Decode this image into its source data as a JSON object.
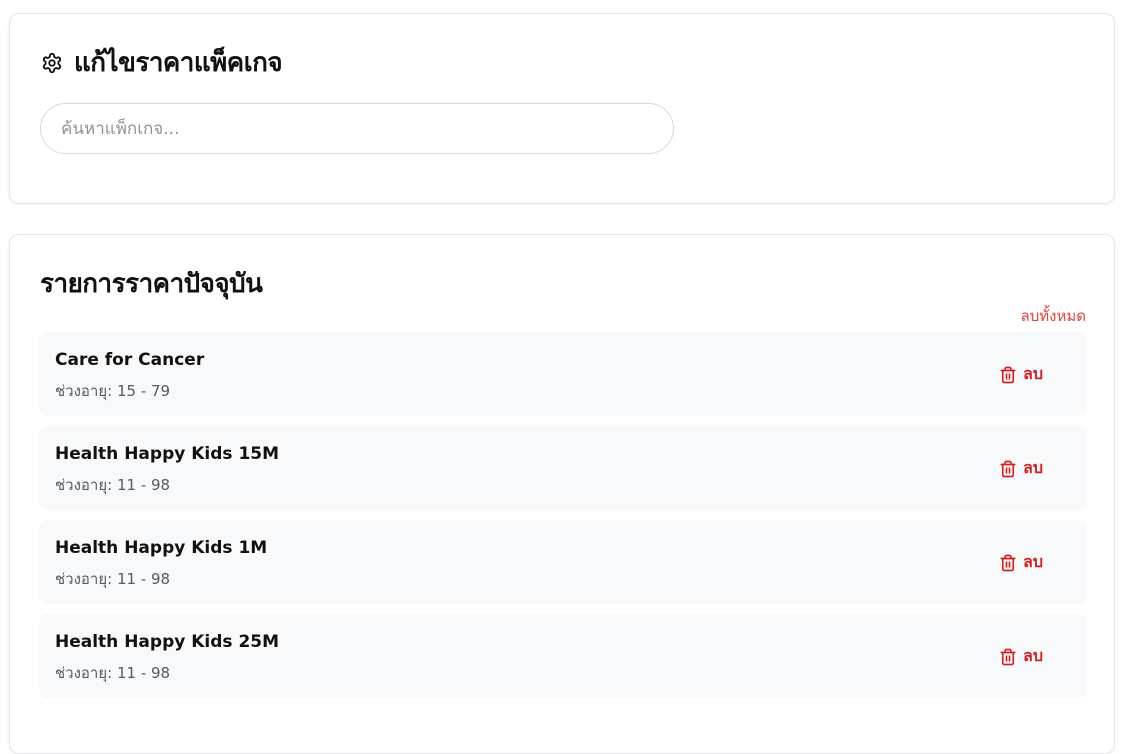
{
  "header": {
    "title": "แก้ไขราคาแพ็คเกจ",
    "icon": "gear-icon"
  },
  "search": {
    "placeholder": "ค้นหาแพ็กเกจ...",
    "value": ""
  },
  "price_list": {
    "title": "รายการราคาปัจจุบัน",
    "clear_all_label": "ลบทั้งหมด",
    "items": [
      {
        "name": "Care for Cancer",
        "age_range": "ช่วงอายุ: 15 - 79",
        "delete_label": "ลบ"
      },
      {
        "name": "Health Happy Kids 15M",
        "age_range": "ช่วงอายุ: 11 - 98",
        "delete_label": "ลบ"
      },
      {
        "name": "Health Happy Kids 1M",
        "age_range": "ช่วงอายุ: 11 - 98",
        "delete_label": "ลบ"
      },
      {
        "name": "Health Happy Kids 25M",
        "age_range": "ช่วงอายุ: 11 - 98",
        "delete_label": "ลบ"
      }
    ]
  },
  "colors": {
    "danger": "#d42020",
    "clear_all": "#e0443e",
    "item_background": "#f8f9fa",
    "border": "#e3e5e8"
  }
}
